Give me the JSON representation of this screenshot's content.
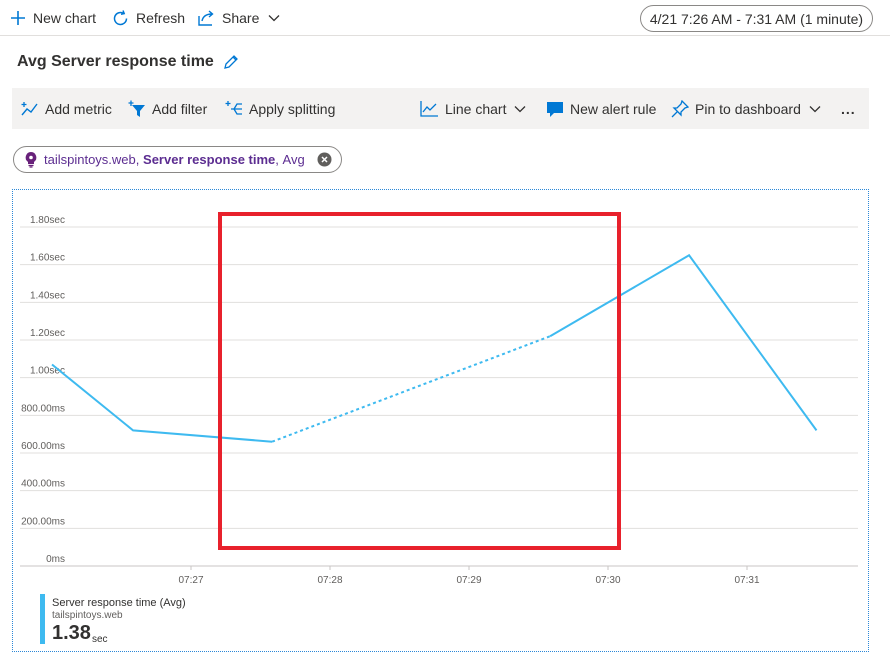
{
  "topbar": {
    "new_chart": "New chart",
    "refresh": "Refresh",
    "share": "Share",
    "time_range": "4/21 7:26 AM - 7:31 AM (1 minute)"
  },
  "title": "Avg Server response time",
  "toolbar": {
    "add_metric": "Add metric",
    "add_filter": "Add filter",
    "apply_splitting": "Apply splitting",
    "chart_type": "Line chart",
    "new_alert_rule": "New alert rule",
    "pin_to_dashboard": "Pin to dashboard",
    "more": "..."
  },
  "metric_pill": {
    "resource": "tailspintoys.web",
    "comma": ",",
    "metric": "Server response time",
    "aggregation": "Avg"
  },
  "colors": {
    "series": "#3ebaf0",
    "highlight_box": "#e8212c",
    "accent": "#0078d4"
  },
  "chart_data": {
    "type": "line",
    "y_tick_labels": [
      "0ms",
      "200.00ms",
      "400.00ms",
      "600.00ms",
      "800.00ms",
      "1.00sec",
      "1.20sec",
      "1.40sec",
      "1.60sec",
      "1.80sec"
    ],
    "x_tick_labels": [
      "07:27",
      "07:28",
      "07:29",
      "07:30",
      "07:31"
    ],
    "ylim": [
      0,
      1800
    ],
    "grid": true,
    "series": [
      {
        "name": "Server response time (Avg)",
        "x": [
          "07:26:00",
          "07:26:35",
          "07:27:35",
          "07:29:35",
          "07:30:35",
          "07:31:30"
        ],
        "y": [
          1070,
          720,
          660,
          1220,
          1650,
          720
        ],
        "segments": [
          {
            "from": 0,
            "to": 2,
            "style": "solid"
          },
          {
            "from": 2,
            "to": 3,
            "style": "dotted"
          },
          {
            "from": 3,
            "to": 5,
            "style": "solid"
          }
        ]
      }
    ],
    "annotation": "highlight box (red rectangle) around the dotted segment"
  },
  "legend": {
    "name": "Server response time (Avg)",
    "resource": "tailspintoys.web",
    "value": "1.38",
    "unit": "sec"
  }
}
